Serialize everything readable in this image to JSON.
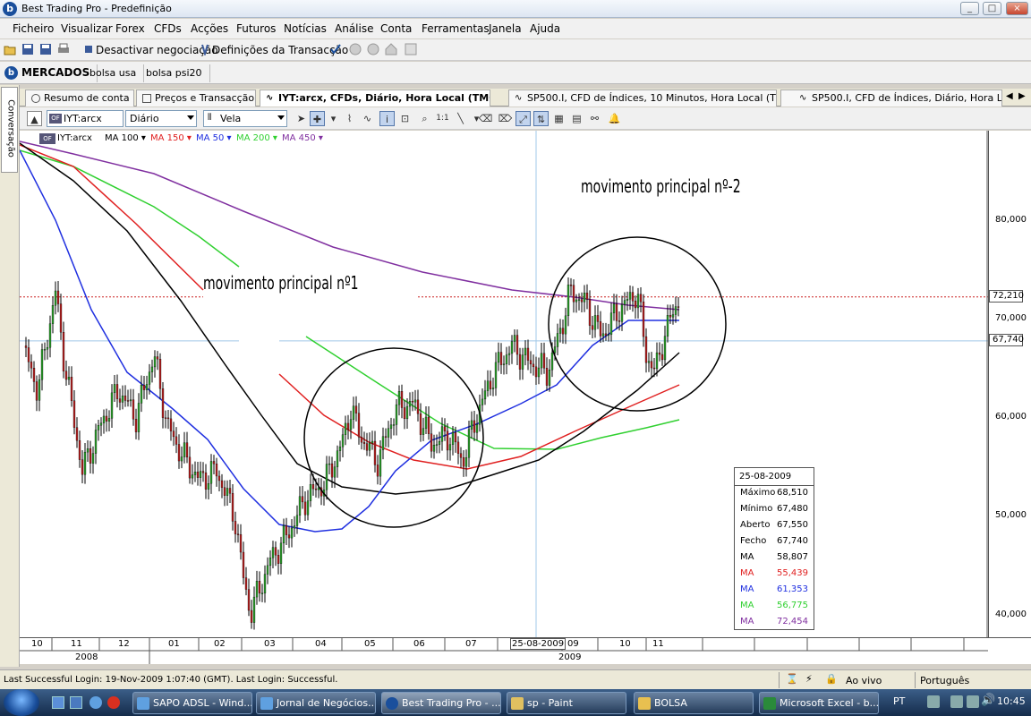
{
  "window": {
    "title": "Best Trading Pro - Predefinição",
    "logo": "b",
    "controls": [
      "_",
      "□",
      "×"
    ]
  },
  "menu": [
    "Ficheiro",
    "Visualizar",
    "Forex",
    "CFDs",
    "Acções",
    "Futuros",
    "Notícias",
    "Análise",
    "Conta",
    "Ferramentas",
    "Janela",
    "Ajuda"
  ],
  "toolbar": {
    "deactivate_label": "Desactivar negociação",
    "settings_label": "Definições da Transacção"
  },
  "markets": {
    "logo": "b",
    "title": "MERCADOS",
    "tabs": [
      "bolsa usa",
      "bolsa psi20"
    ]
  },
  "sidebar": {
    "tab_label": "Conversação"
  },
  "doc_tabs": [
    "Resumo de conta",
    "Preços e Transacção",
    "IYT:arcx, CFDs, Diário, Hora Local (TMG+0)",
    "SP500.I, CFD de Índices, 10 Minutos, Hora Local (TMG+0)",
    "SP500.I, CFD de Índices, Diário, Hora Local (TI"
  ],
  "chart_toolbar": {
    "symbol": "IYT:arcx",
    "period": "Diário",
    "style": "Vela",
    "symbol_badge": "OF"
  },
  "legend": {
    "symbol": "IYT:arcx",
    "items": [
      {
        "label": "MA 100",
        "color": "#000000"
      },
      {
        "label": "MA 150",
        "color": "#e02020"
      },
      {
        "label": "MA 50",
        "color": "#2030e0"
      },
      {
        "label": "MA 200",
        "color": "#30d030"
      },
      {
        "label": "MA 450",
        "color": "#8030a0"
      }
    ]
  },
  "annotations": {
    "main1": "movimento principal nº1",
    "main2": "movimento principal nº-2"
  },
  "price_axis": {
    "ticks": [
      "80,000",
      "70,000",
      "60,000",
      "50,000",
      "40,000"
    ],
    "marker_high": "72,210",
    "marker_close": "67,740"
  },
  "x_axis": {
    "months": [
      "10",
      "11",
      "12",
      "01",
      "02",
      "03",
      "04",
      "05",
      "06",
      "07",
      "25-08-2009",
      "09",
      "10",
      "11"
    ],
    "years": [
      "2008",
      "2009"
    ]
  },
  "info_box": {
    "date": "25-08-2009",
    "rows": [
      {
        "k": "Máximo",
        "v": "68,510",
        "color": "#000000"
      },
      {
        "k": "Mínimo",
        "v": "67,480",
        "color": "#000000"
      },
      {
        "k": "Aberto",
        "v": "67,550",
        "color": "#000000"
      },
      {
        "k": "Fecho",
        "v": "67,740",
        "color": "#000000"
      },
      {
        "k": "MA",
        "v": "58,807",
        "color": "#000000"
      },
      {
        "k": "MA",
        "v": "55,439",
        "color": "#e02020"
      },
      {
        "k": "MA",
        "v": "61,353",
        "color": "#2030e0"
      },
      {
        "k": "MA",
        "v": "56,775",
        "color": "#30d030"
      },
      {
        "k": "MA",
        "v": "72,454",
        "color": "#8030a0"
      }
    ]
  },
  "status": {
    "login_text": "Last Successful Login: 19-Nov-2009 1:07:40 (GMT). Last Login: Successful.",
    "mode": "Ao vivo",
    "language": "Português"
  },
  "taskbar": {
    "tasks": [
      "SAPO ADSL - Wind...",
      "Jornal de Negócios...",
      "Best Trading Pro - ...",
      "sp - Paint",
      "BOLSA",
      "Microsoft Excel - b..."
    ],
    "lang": "PT",
    "clock": "10:45"
  }
}
